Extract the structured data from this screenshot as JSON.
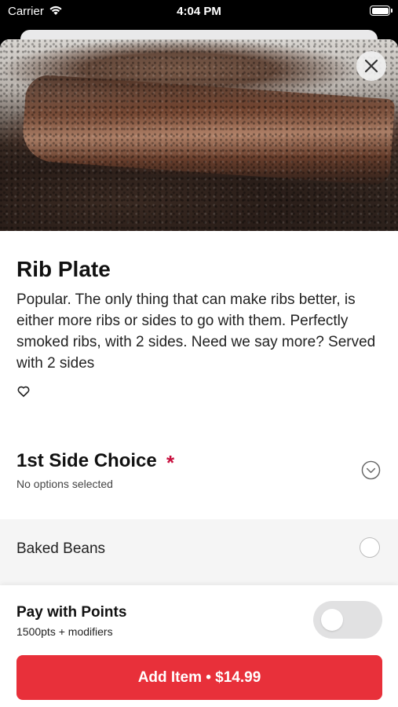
{
  "status_bar": {
    "carrier": "Carrier",
    "time": "4:04 PM",
    "wifi_icon": "wifi-icon",
    "battery_icon": "battery-icon"
  },
  "hero": {
    "image_description_icon": "food-photo"
  },
  "item": {
    "name": "Rib Plate",
    "description": "Popular. The only thing that can make ribs better, is either more ribs or sides to go with them. Perfectly smoked ribs, with 2 sides. Need we say more? Served with 2 sides"
  },
  "side_choice": {
    "title": "1st Side Choice",
    "required_marker": "*",
    "status": "No options selected",
    "options": [
      {
        "label": "Baked Beans",
        "selected": false
      }
    ]
  },
  "points": {
    "title": "Pay with Points",
    "subtitle": "1500pts + modifiers",
    "enabled": false
  },
  "add_button": {
    "label": "Add Item • $14.99"
  },
  "colors": {
    "accent": "#e8303a",
    "required": "#c8103e"
  }
}
